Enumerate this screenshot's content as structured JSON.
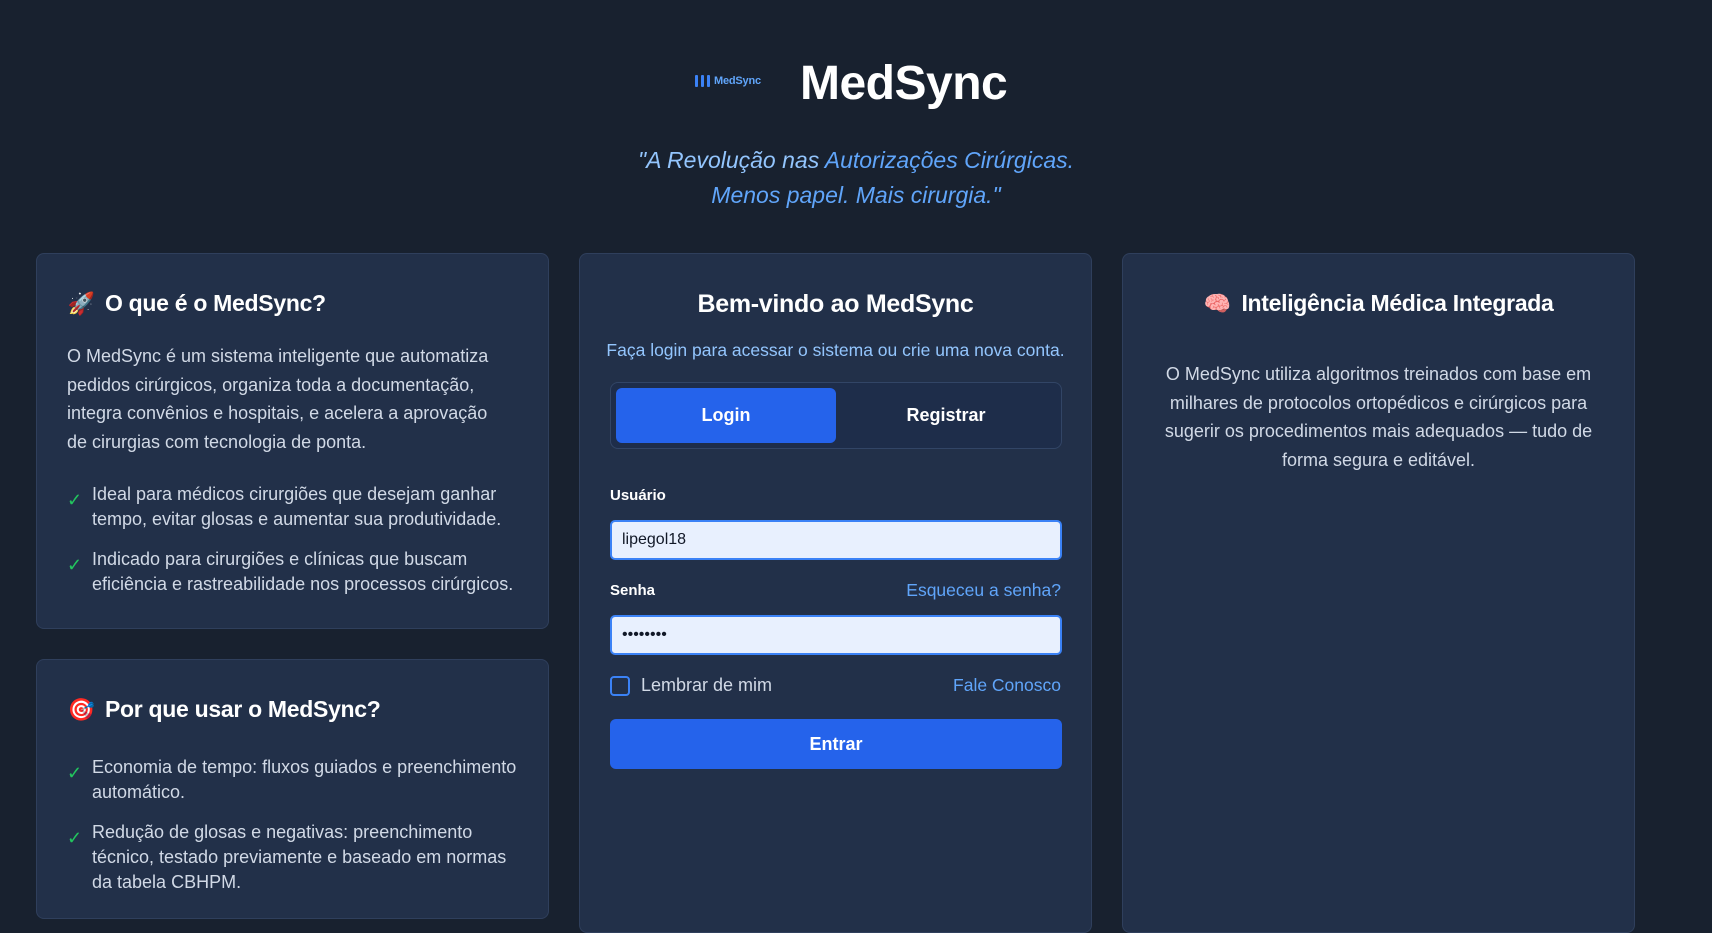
{
  "header": {
    "logo_text": "MedSync",
    "title": "MedSync",
    "tagline_line1_prefix": "\"A Revolução nas ",
    "tagline_line1_highlight": "Autorizações Cirúrgicas.",
    "tagline_line2": "Menos papel. Mais cirurgia.\""
  },
  "about_card": {
    "icon": "rocket-icon",
    "emoji": "🚀",
    "heading": "O que é o MedSync?",
    "paragraph": "O MedSync é um sistema inteligente que automatiza pedidos cirúrgicos, organiza toda a documentação, integra convênios e hospitais, e acelera a aprovação de cirurgias com tecnologia de ponta.",
    "items": [
      "Ideal para médicos cirurgiões que desejam ganhar tempo, evitar glosas e aumentar sua produtividade.",
      "Indicado para cirurgiões e clínicas que buscam eficiência e rastreabilidade nos processos cirúrgicos."
    ]
  },
  "why_card": {
    "icon": "target-icon",
    "emoji": "🎯",
    "heading": "Por que usar o MedSync?",
    "items": [
      "Economia de tempo: fluxos guiados e preenchimento automático.",
      "Redução de glosas e negativas: preenchimento técnico, testado previamente e baseado em normas da tabela CBHPM."
    ]
  },
  "login_card": {
    "title": "Bem-vindo ao MedSync",
    "subtitle": "Faça login para acessar o sistema ou crie uma nova conta.",
    "tabs": {
      "login": "Login",
      "register": "Registrar"
    },
    "username_label": "Usuário",
    "username_value": "lipegol18",
    "password_label": "Senha",
    "password_value": "••••••••",
    "forgot_password": "Esqueceu a senha?",
    "remember_me": "Lembrar de mim",
    "contact": "Fale Conosco",
    "submit": "Entrar"
  },
  "ai_card": {
    "icon": "brain-icon",
    "emoji": "🧠",
    "heading": "Inteligência Médica Integrada",
    "paragraph": "O MedSync utiliza algoritmos treinados com base em milhares de protocolos ortopédicos e cirúrgicos para sugerir os procedimentos mais adequados — tudo de forma segura e editável."
  },
  "colors": {
    "background": "#18212f",
    "card": "#223049",
    "accent": "#2563eb",
    "link": "#60a5fa",
    "check": "#22c55e"
  }
}
